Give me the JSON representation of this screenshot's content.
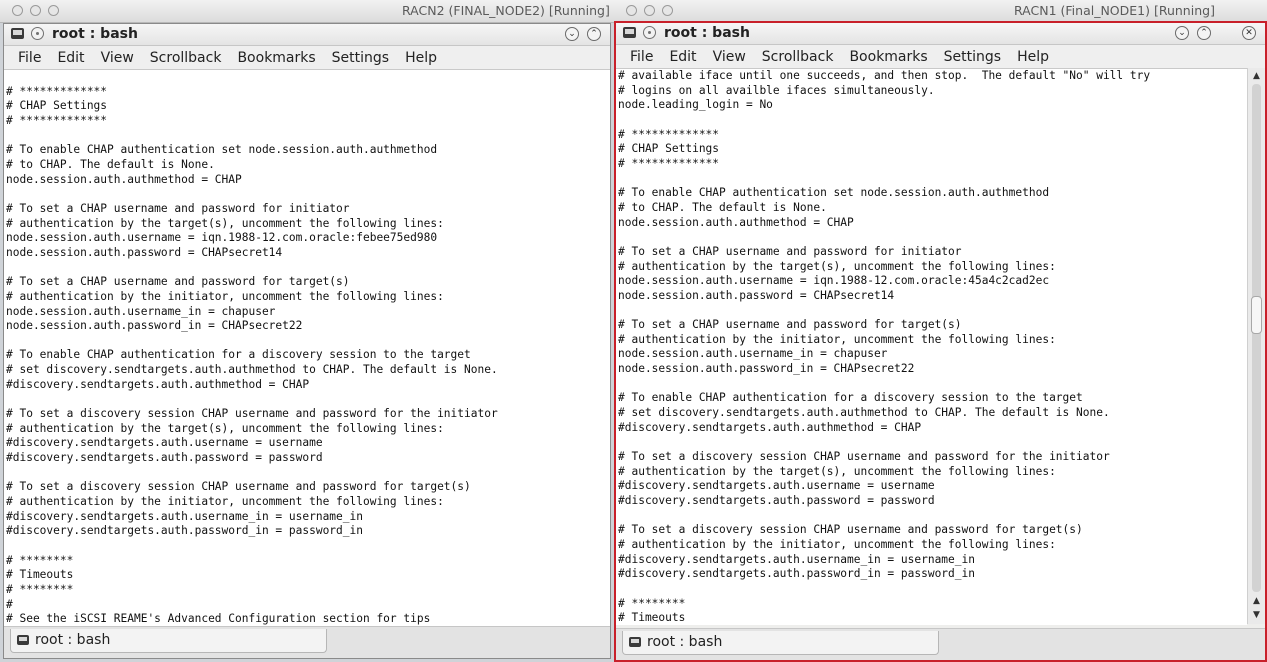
{
  "vm_left": {
    "title": "RACN2 (FINAL_NODE2) [Running]"
  },
  "vm_right": {
    "title": "RACN1 (Final_NODE1) [Running]"
  },
  "konsole": {
    "title": "root : bash",
    "menu": [
      "File",
      "Edit",
      "View",
      "Scrollback",
      "Bookmarks",
      "Settings",
      "Help"
    ],
    "tab_label": "root : bash",
    "icons": {
      "terminal": "terminal-icon",
      "pin": "pin-icon",
      "minimize": "chevron-down-icon",
      "maximize": "chevron-up-icon",
      "close": "close-icon"
    }
  },
  "terminal_left": {
    "lines": [
      "",
      "# *************",
      "# CHAP Settings",
      "# *************",
      "",
      "# To enable CHAP authentication set node.session.auth.authmethod",
      "# to CHAP. The default is None.",
      "node.session.auth.authmethod = CHAP",
      "",
      "# To set a CHAP username and password for initiator",
      "# authentication by the target(s), uncomment the following lines:",
      "node.session.auth.username = iqn.1988-12.com.oracle:febee75ed980",
      "node.session.auth.password = CHAPsecret14",
      "",
      "# To set a CHAP username and password for target(s)",
      "# authentication by the initiator, uncomment the following lines:",
      "node.session.auth.username_in = chapuser",
      "node.session.auth.password_in = CHAPsecret22",
      "",
      "# To enable CHAP authentication for a discovery session to the target",
      "# set discovery.sendtargets.auth.authmethod to CHAP. The default is None.",
      "#discovery.sendtargets.auth.authmethod = CHAP",
      "",
      "# To set a discovery session CHAP username and password for the initiator",
      "# authentication by the target(s), uncomment the following lines:",
      "#discovery.sendtargets.auth.username = username",
      "#discovery.sendtargets.auth.password = password",
      "",
      "# To set a discovery session CHAP username and password for target(s)",
      "# authentication by the initiator, uncomment the following lines:",
      "#discovery.sendtargets.auth.username_in = username_in",
      "#discovery.sendtargets.auth.password_in = password_in",
      "",
      "# ********",
      "# Timeouts",
      "# ********",
      "#",
      "# See the iSCSI REAME's Advanced Configuration section for tips"
    ]
  },
  "terminal_right": {
    "lines": [
      "# available iface until one succeeds, and then stop.  The default \"No\" will try",
      "# logins on all availble ifaces simultaneously.",
      "node.leading_login = No",
      "",
      "# *************",
      "# CHAP Settings",
      "# *************",
      "",
      "# To enable CHAP authentication set node.session.auth.authmethod",
      "# to CHAP. The default is None.",
      "node.session.auth.authmethod = CHAP",
      "",
      "# To set a CHAP username and password for initiator",
      "# authentication by the target(s), uncomment the following lines:",
      "node.session.auth.username = iqn.1988-12.com.oracle:45a4c2cad2ec",
      "node.session.auth.password = CHAPsecret14",
      "",
      "# To set a CHAP username and password for target(s)",
      "# authentication by the initiator, uncomment the following lines:",
      "node.session.auth.username_in = chapuser",
      "node.session.auth.password_in = CHAPsecret22",
      "",
      "# To enable CHAP authentication for a discovery session to the target",
      "# set discovery.sendtargets.auth.authmethod to CHAP. The default is None.",
      "#discovery.sendtargets.auth.authmethod = CHAP",
      "",
      "# To set a discovery session CHAP username and password for the initiator",
      "# authentication by the target(s), uncomment the following lines:",
      "#discovery.sendtargets.auth.username = username",
      "#discovery.sendtargets.auth.password = password",
      "",
      "# To set a discovery session CHAP username and password for target(s)",
      "# authentication by the initiator, uncomment the following lines:",
      "#discovery.sendtargets.auth.username_in = username_in",
      "#discovery.sendtargets.auth.password_in = password_in",
      "",
      "# ********",
      "# Timeouts"
    ],
    "scroll_position": 0.45
  },
  "colors": {
    "vm_right_frame": "#c8202a",
    "terminal_bg": "#ffffff",
    "terminal_fg": "#111111"
  }
}
